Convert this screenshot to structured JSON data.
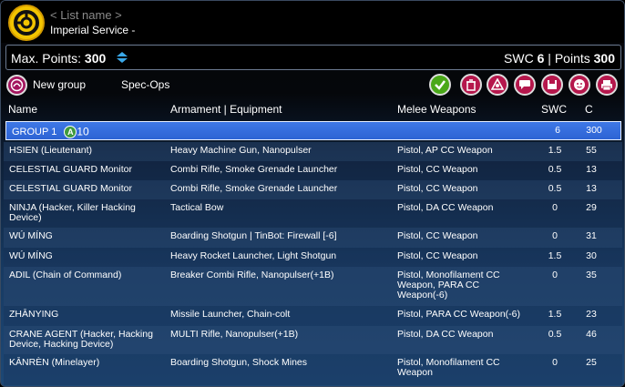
{
  "header": {
    "logo": "yu-jing-logo",
    "list_name": "< List name >",
    "army_name": "Imperial Service -"
  },
  "points_bar": {
    "max_points_label": "Max. Points:",
    "max_points_value": "300",
    "swc_label": "SWC",
    "swc_value": "6",
    "separator": "|",
    "points_label": "Points",
    "points_value": "300"
  },
  "toolbar": {
    "new_group_label": "New group",
    "spec_ops_label": "Spec-Ops",
    "icons": [
      "validate-check-icon",
      "delete-trash-icon",
      "army-logo-icon",
      "chat-icon",
      "save-icon",
      "face-icon",
      "print-icon"
    ],
    "colors": {
      "validate": "#4aa818",
      "delete": "#b5174c",
      "army": "#b5174c",
      "chat": "#b5174c",
      "save": "#b5174c",
      "face": "#b5174c",
      "print": "#b5174c"
    }
  },
  "table": {
    "headers": {
      "name": "Name",
      "armament": "Armament | Equipment",
      "melee": "Melee Weapons",
      "swc": "SWC",
      "cost": "C"
    },
    "group_row": {
      "name": "GROUP 1",
      "badge": "A",
      "count": "10",
      "swc": "6",
      "cost": "300"
    },
    "rows": [
      {
        "name": "HSIEN (Lieutenant)",
        "armament": "Heavy Machine Gun, Nanopulser",
        "melee": "Pistol, AP CC Weapon",
        "swc": "1.5",
        "cost": "55"
      },
      {
        "name": "CELESTIAL GUARD Monitor",
        "armament": "Combi Rifle, Smoke Grenade Launcher",
        "melee": "Pistol, CC Weapon",
        "swc": "0.5",
        "cost": "13"
      },
      {
        "name": "CELESTIAL GUARD Monitor",
        "armament": "Combi Rifle, Smoke Grenade Launcher",
        "melee": "Pistol, CC Weapon",
        "swc": "0.5",
        "cost": "13"
      },
      {
        "name": "NINJA (Hacker, Killer Hacking Device)",
        "armament": "Tactical Bow",
        "melee": "Pistol, DA CC Weapon",
        "swc": "0",
        "cost": "29"
      },
      {
        "name": "WÚ MÍNG",
        "armament": "Boarding Shotgun | TinBot: Firewall [-6]",
        "melee": "Pistol, CC Weapon",
        "swc": "0",
        "cost": "31"
      },
      {
        "name": "WÚ MÍNG",
        "armament": "Heavy Rocket Launcher, Light Shotgun",
        "melee": "Pistol, CC Weapon",
        "swc": "1.5",
        "cost": "30"
      },
      {
        "name": "ADIL (Chain of Command)",
        "armament": "Breaker Combi Rifle, Nanopulser(+1B)",
        "melee": "Pistol, Monofilament CC Weapon, PARA CC Weapon(-6)",
        "swc": "0",
        "cost": "35"
      },
      {
        "name": "ZHĀNYING",
        "armament": "Missile Launcher, Chain-colt",
        "melee": "Pistol, PARA CC Weapon(-6)",
        "swc": "1.5",
        "cost": "23"
      },
      {
        "name": "CRANE AGENT (Hacker, Hacking Device, Hacking Device)",
        "armament": "MULTI Rifle, Nanopulser(+1B)",
        "melee": "Pistol, DA CC Weapon",
        "swc": "0.5",
        "cost": "46"
      },
      {
        "name": "KĀNRÈN (Minelayer)",
        "armament": "Boarding Shotgun, Shock Mines",
        "melee": "Pistol, Monofilament CC Weapon",
        "swc": "0",
        "cost": "25"
      }
    ]
  }
}
